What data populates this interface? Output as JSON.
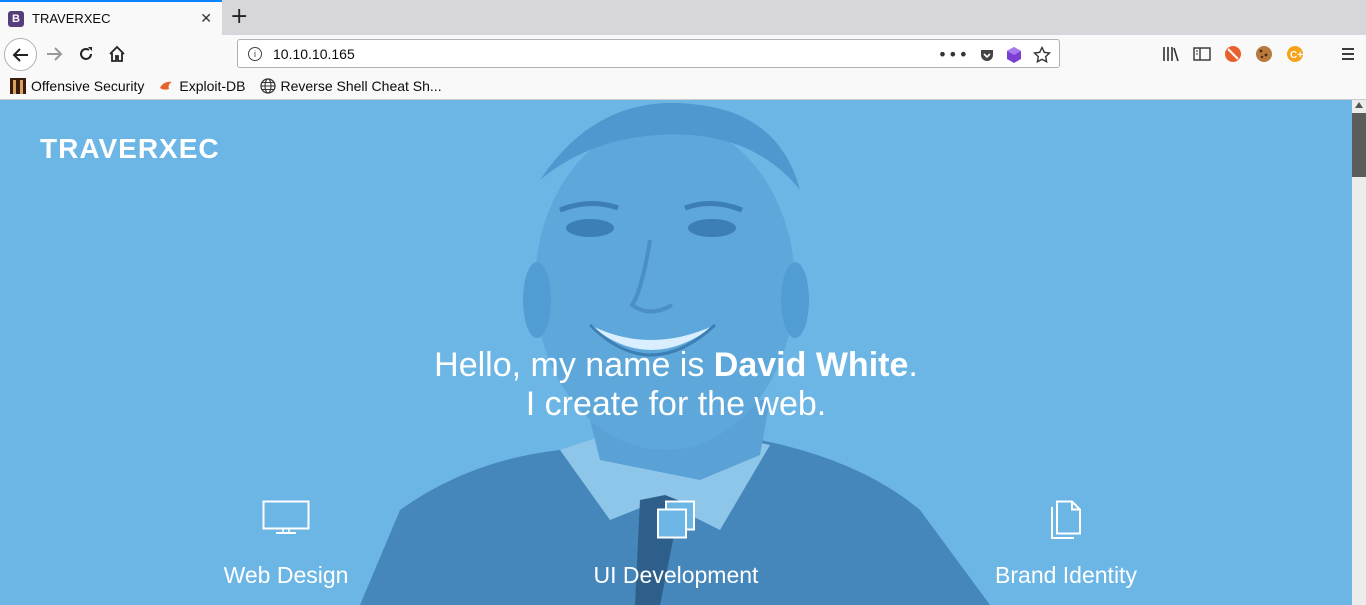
{
  "browser": {
    "tab_title": "TRAVERXEC",
    "tab_favicon": "B",
    "url": "10.10.10.165",
    "bookmarks": [
      {
        "label": "Offensive Security"
      },
      {
        "label": "Exploit-DB"
      },
      {
        "label": "Reverse Shell Cheat Sh..."
      }
    ]
  },
  "page": {
    "brand": "TRAVERXEC",
    "hero": {
      "greeting": "Hello, my name is ",
      "name": "David White",
      "period": ".",
      "tagline": "I create for the web."
    },
    "services": [
      {
        "label": "Web Design",
        "icon": "monitor-icon"
      },
      {
        "label": "UI Development",
        "icon": "windows-icon"
      },
      {
        "label": "Brand Identity",
        "icon": "documents-icon"
      }
    ],
    "colors": {
      "background": "#6cb6e6",
      "accent": "#0a84ff"
    }
  }
}
